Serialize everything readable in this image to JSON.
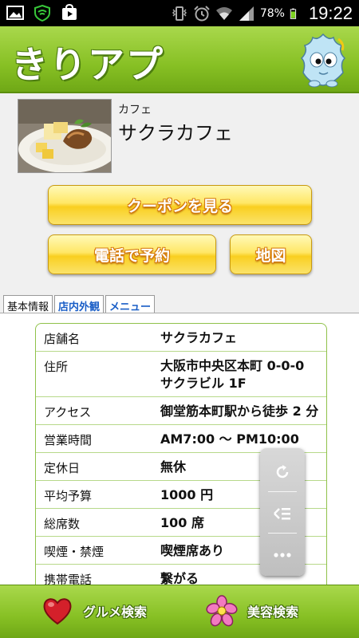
{
  "status_bar": {
    "battery_percent": "78%",
    "time": "19:22",
    "left_icons": [
      "image-icon",
      "wifi-shield-icon",
      "play-store-icon"
    ],
    "right_icons": [
      "vibrate-icon",
      "alarm-icon",
      "wifi-icon",
      "signal-icon",
      "battery-icon"
    ]
  },
  "header": {
    "app_title": "きりアプ"
  },
  "shop": {
    "category": "カフェ",
    "name": "サクラカフェ"
  },
  "buttons": {
    "coupon": "クーポンを見る",
    "phone_reserve": "電話で予約",
    "map": "地図"
  },
  "tabs": [
    {
      "label": "基本情報",
      "active": true
    },
    {
      "label": "店内外観",
      "active": false
    },
    {
      "label": "メニュー",
      "active": false
    }
  ],
  "info": {
    "rows": [
      {
        "key": "店舗名",
        "value": "サクラカフェ"
      },
      {
        "key": "住所",
        "value": "大阪市中央区本町 0-0-0",
        "value2": "サクラビル 1F"
      },
      {
        "key": "アクセス",
        "value": "御堂筋本町駅から徒歩 2 分"
      },
      {
        "key": "営業時間",
        "value": "AM7:00 ～ PM10:00"
      },
      {
        "key": "定休日",
        "value": "無休"
      },
      {
        "key": "平均予算",
        "value": "1000 円"
      },
      {
        "key": "総席数",
        "value": "100 席"
      },
      {
        "key": "喫煙・禁煙",
        "value": "喫煙席あり"
      },
      {
        "key": "携帯電話",
        "value": "繋がる"
      }
    ]
  },
  "footer": {
    "gourmet": "グルメ検索",
    "beauty": "美容検索"
  },
  "colors": {
    "header_green": "#87c024",
    "button_yellow": "#f9cf20",
    "tab_link_blue": "#1a5ec7",
    "table_border": "#8fc24a"
  }
}
